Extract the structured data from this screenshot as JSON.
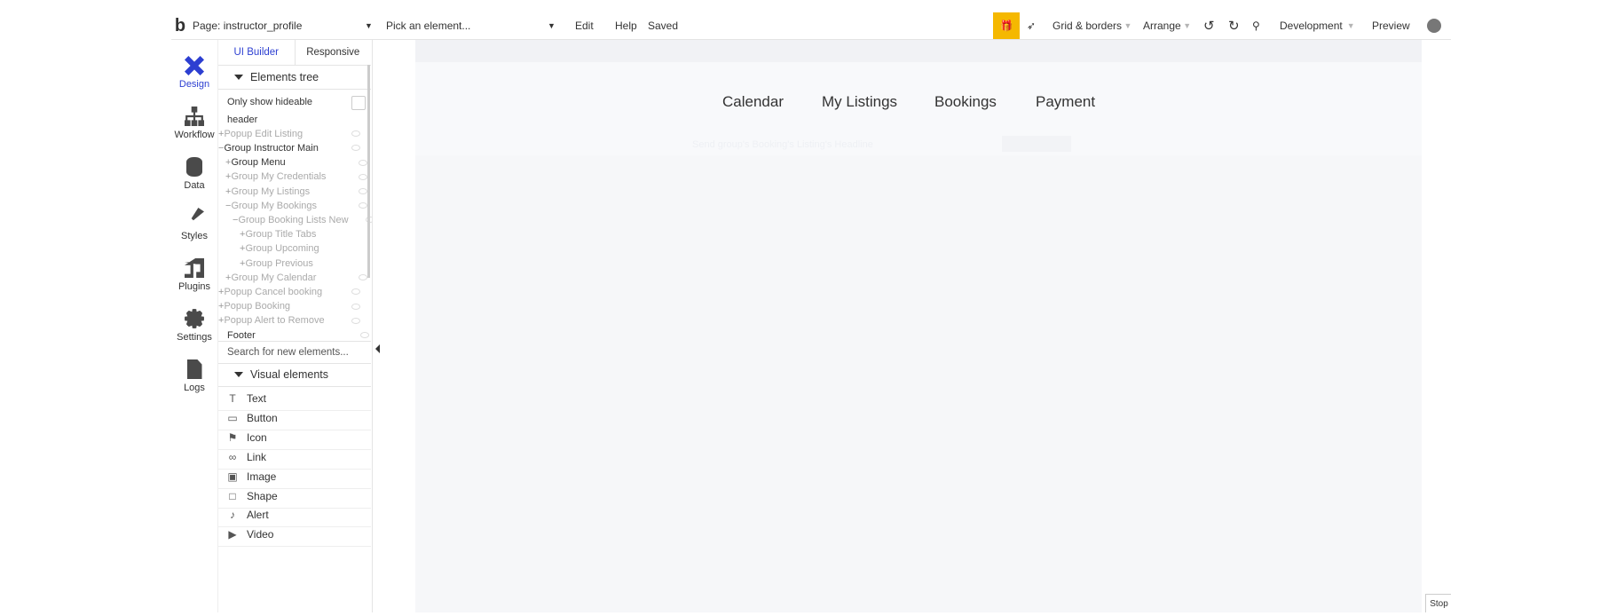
{
  "topbar": {
    "logo": "b",
    "page_label": "Page: instructor_profile",
    "element_picker": "Pick an element...",
    "edit": "Edit",
    "help": "Help",
    "status": "Saved",
    "grid": "Grid & borders",
    "arrange": "Arrange",
    "env": "Development",
    "preview": "Preview"
  },
  "iconbar": {
    "design": "Design",
    "workflow": "Workflow",
    "data": "Data",
    "styles": "Styles",
    "plugins": "Plugins",
    "settings": "Settings",
    "logs": "Logs"
  },
  "panel": {
    "tab_ui_builder": "UI Builder",
    "tab_responsive": "Responsive",
    "tree_title": "Elements tree",
    "only_hideable": "Only show hideable",
    "tree": [
      {
        "prefix": "",
        "label": "header",
        "dim": false
      },
      {
        "prefix": "+",
        "label": "Popup Edit Listing",
        "dim": true
      },
      {
        "prefix": "−",
        "label": "Group Instructor Main",
        "dim": false
      },
      {
        "prefix": "+",
        "label": "Group Menu",
        "dim": false
      },
      {
        "prefix": "+",
        "label": "Group My Credentials",
        "dim": true
      },
      {
        "prefix": "+",
        "label": "Group My Listings",
        "dim": true
      },
      {
        "prefix": "−",
        "label": "Group My Bookings",
        "dim": true
      },
      {
        "prefix": "−",
        "label": "Group Booking Lists New",
        "dim": true
      },
      {
        "prefix": "+",
        "label": "Group Title Tabs",
        "dim": true
      },
      {
        "prefix": "+",
        "label": "Group Upcoming",
        "dim": true
      },
      {
        "prefix": "+",
        "label": "Group Previous",
        "dim": true
      },
      {
        "prefix": "+",
        "label": "Group My Calendar",
        "dim": true
      },
      {
        "prefix": "+",
        "label": "Popup Cancel booking",
        "dim": true
      },
      {
        "prefix": "+",
        "label": "Popup Booking",
        "dim": true
      },
      {
        "prefix": "+",
        "label": "Popup Alert to Remove",
        "dim": true
      },
      {
        "prefix": "",
        "label": "Footer",
        "dim": false
      }
    ],
    "search_placeholder": "Search for new elements...",
    "visual_title": "Visual elements",
    "visual_elements": [
      {
        "icon": "text-icon",
        "glyph": "T",
        "label": "Text"
      },
      {
        "icon": "button-icon",
        "glyph": "▭",
        "label": "Button"
      },
      {
        "icon": "flag-icon",
        "glyph": "⚑",
        "label": "Icon"
      },
      {
        "icon": "link-icon",
        "glyph": "∞",
        "label": "Link"
      },
      {
        "icon": "image-icon",
        "glyph": "▣",
        "label": "Image"
      },
      {
        "icon": "shape-icon",
        "glyph": "□",
        "label": "Shape"
      },
      {
        "icon": "bell-icon",
        "glyph": "♪",
        "label": "Alert"
      },
      {
        "icon": "video-icon",
        "glyph": "▶",
        "label": "Video"
      }
    ]
  },
  "canvas": {
    "menu": [
      "Calendar",
      "My Listings",
      "Bookings",
      "Payment"
    ],
    "faint_text": "Send group's Booking's Listing's Headline"
  },
  "stop_label": "Stop",
  "colors": {
    "accent": "#2d3fd1",
    "gift": "#f5b800",
    "preview": "#2d5dce"
  }
}
